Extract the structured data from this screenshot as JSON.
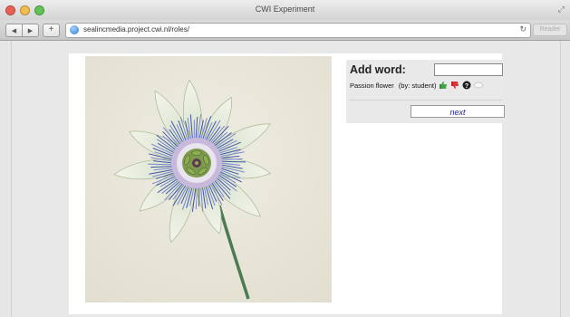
{
  "window": {
    "title": "CWI Experiment"
  },
  "toolbar": {
    "url": "sealincmedia.project.cwi.nl/roles/",
    "reader_label": "Reader"
  },
  "form": {
    "add_word_label": "Add word:",
    "input_value": "",
    "tag": {
      "name": "Passion flower",
      "author": "(by: student)"
    },
    "next_label": "next"
  },
  "colors": {
    "next_text": "#22229a",
    "page_bg": "#e8e8e8",
    "panel_bg": "#e9e9e9"
  },
  "icons": [
    "thumbs-up-icon",
    "thumbs-down-icon",
    "question-icon",
    "toggle-icon"
  ]
}
